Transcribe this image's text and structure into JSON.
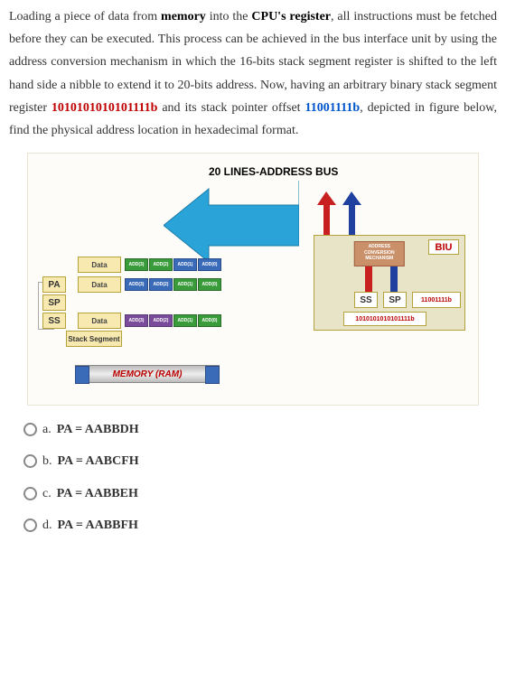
{
  "question": {
    "p1a": "Loading a piece of data from ",
    "p1b": "memory",
    "p1c": " into the ",
    "p1d": "CPU's register",
    "p1e": ", all instructions must be fetched before they can be executed. This process can be achieved in the bus interface unit by using the address conversion mechanism in which the 16-bits stack segment register is shifted to the left hand side a nibble to extend it to 20-bits address. Now, having an arbitrary binary stack segment register ",
    "ss_val": "1010101010101111b",
    "p1f": " and its stack pointer offset ",
    "sp_val": "11001111b",
    "p1g": ", depicted in figure below, find the physical address location in hexadecimal format."
  },
  "diagram": {
    "bus_title": "20 LINES-ADDRESS BUS",
    "labels": {
      "pa": "PA",
      "sp": "SP",
      "ss": "SS"
    },
    "data_label": "Data",
    "stack_segment": "Stack Segment",
    "memory_bar": "MEMORY (RAM)",
    "biu": "BIU",
    "conv": "ADDRESS\nCONVERSION\nMECHANISM",
    "ss_box": "SS",
    "sp_box": "SP",
    "sp_value": "11001111b",
    "ss_value": "1010101010101111b",
    "chips": [
      "ADD(3)",
      "ADD(2)",
      "ADD(1)",
      "ADD(0)"
    ]
  },
  "options": {
    "a": {
      "letter": "a.",
      "text": "PA = AABBDH"
    },
    "b": {
      "letter": "b.",
      "text": "PA = AABCFH"
    },
    "c": {
      "letter": "c.",
      "text": "PA = AABBEH"
    },
    "d": {
      "letter": "d.",
      "text": "PA = AABBFH"
    }
  }
}
